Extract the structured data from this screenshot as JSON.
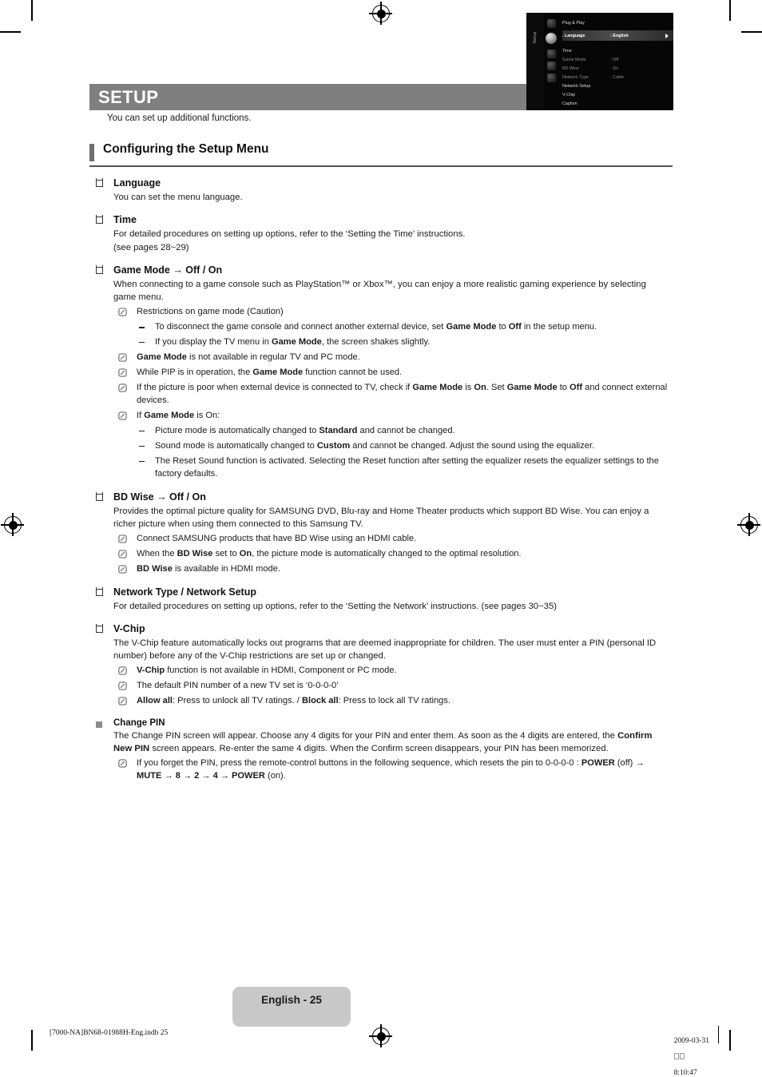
{
  "header": {
    "title": "SETUP",
    "intro": "You can set up additional functions.",
    "section_title": "Configuring the Setup Menu"
  },
  "colors": {
    "title_bar": "#7f7f7f",
    "section_accent": "#6f6f6f",
    "page_badge": "#c8c8c8",
    "sub_bullet": "#8c8c8c"
  },
  "osd": {
    "side_label": "Setup",
    "rows": [
      {
        "name": "Plug & Play",
        "value": "",
        "state": "bright"
      },
      {
        "name": ". Language",
        "value": ": English",
        "state": "selected"
      },
      {
        "name": "Time",
        "value": "",
        "state": "bright"
      },
      {
        "name": "Game Mode",
        "value": ": Off",
        "state": "dim"
      },
      {
        "name": "BD Wise",
        "value": ": On",
        "state": "dim"
      },
      {
        "name": "Network Type",
        "value": ": Cable",
        "state": "dim"
      },
      {
        "name": "Network Setup",
        "value": "",
        "state": "bright"
      },
      {
        "name": "V-Chip",
        "value": "",
        "state": "bright"
      },
      {
        "name": "Caption",
        "value": "",
        "state": "bright"
      }
    ]
  },
  "sections": {
    "language": {
      "heading": "Language",
      "body": "You can set the menu language."
    },
    "time": {
      "heading": "Time",
      "body_line1": "For detailed procedures on setting up options, refer to the ‘Setting the Time’ instructions.",
      "body_line2": "(see pages 28~29)"
    },
    "game_mode": {
      "heading": "Game Mode → Off / On",
      "body": "When connecting to a game console such as PlayStation™ or Xbox™, you can enjoy a more realistic gaming experience by selecting game menu.",
      "note1": "Restrictions on game mode (Caution)",
      "dash1": "To disconnect the game console and connect another external device, set Game Mode to Off in the setup menu.",
      "dash2": "If you display the TV menu in Game Mode, the screen shakes slightly.",
      "note2": "Game Mode is not available in regular TV and PC mode.",
      "note3": "While PIP is in operation, the Game Mode function cannot be used.",
      "note4": "If the picture is poor when external device is connected to TV, check if Game Mode is On. Set Game Mode to Off and connect external devices.",
      "note5": "If Game Mode is On:",
      "dash3": "Picture mode is automatically changed to Standard and cannot be changed.",
      "dash4": "Sound mode is automatically changed to Custom and cannot be changed. Adjust the sound using the equalizer.",
      "dash5": "The Reset Sound function is activated. Selecting the Reset function after setting the equalizer resets the equalizer settings to the factory defaults."
    },
    "bd_wise": {
      "heading": "BD Wise → Off / On",
      "body": "Provides the optimal picture quality for SAMSUNG DVD, Blu-ray and Home Theater products which support BD Wise. You can enjoy a richer picture when using them connected to this Samsung TV.",
      "note1": "Connect SAMSUNG products that have BD Wise using an HDMI cable.",
      "note2": "When the BD Wise set to On, the picture mode is automatically changed to the optimal resolution.",
      "note3": "BD Wise is available in HDMI mode."
    },
    "network": {
      "heading": "Network Type / Network Setup",
      "body": "For detailed procedures on setting up options, refer to the ‘Setting the Network’ instructions. (see pages 30~35)"
    },
    "vchip": {
      "heading": "V-Chip",
      "body": "The V-Chip feature automatically locks out programs that are deemed inappropriate for children. The user must enter a PIN (personal ID number) before any of the V-Chip restrictions are set up or changed.",
      "note1": "V-Chip function is not available in HDMI, Component or PC mode.",
      "note2": "The default PIN number of a new TV set is ‘0-0-0-0’",
      "note3": "Allow all: Press to unlock all TV ratings. / Block all: Press to lock all TV ratings."
    },
    "change_pin": {
      "heading": "Change PIN",
      "body": "The Change PIN screen will appear. Choose any 4 digits for your PIN and enter them. As soon as the 4 digits are entered, the Confirm New PIN screen appears. Re-enter the same 4 digits. When the Confirm screen disappears, your PIN has been memorized.",
      "note1": "If you forget the PIN, press the remote-control buttons in the following sequence, which resets the pin to 0-0-0-0 : POWER (off) → MUTE → 8 → 2 → 4 → POWER (on)."
    }
  },
  "footer": {
    "page_label": "English - 25",
    "file_ref": "[7000-NA]BN68-01988H-Eng.indb   25",
    "date": "2009-03-31",
    "time": "8:10:47"
  }
}
